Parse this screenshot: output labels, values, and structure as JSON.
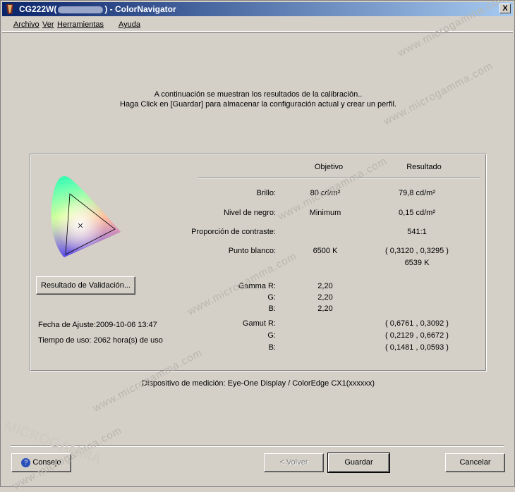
{
  "window": {
    "title_prefix": "CG222W(",
    "title_suffix": ") - ColorNavigator",
    "close_label": "X"
  },
  "menu": {
    "items": [
      "Archivo",
      "Ver",
      "Herramientas",
      "Ayuda"
    ]
  },
  "instructions": {
    "line1": "A continuación se muestran los resultados de la calibración..",
    "line2": "Haga Click en  [Guardar] para almacenar la configuración actual y crear un perfil."
  },
  "left": {
    "validation_button": "Resultado de Validación...",
    "fecha": "Fecha de Ajuste:2009-10-06 13:47",
    "tiempo": "Tiempo de uso: 2062 hora(s) de uso"
  },
  "table": {
    "col_objetivo": "Objetivo",
    "col_resultado": "Resultado",
    "brillo": {
      "label": "Brillo:",
      "objetivo": "80 cd/m²",
      "resultado": "79,8 cd/m²"
    },
    "negro": {
      "label": "Nivel de negro:",
      "objetivo": "Minimum",
      "resultado": "0,15 cd/m²"
    },
    "contraste": {
      "label": "Proporción de contraste:",
      "resultado": "541:1"
    },
    "blanco": {
      "label": "Punto blanco:",
      "objetivo": "6500 K",
      "resultado": "( 0,3120 , 0,3295 )",
      "resultado2": "6539 K"
    },
    "gamma": {
      "label_r": "Gamma R:",
      "label_g": "G:",
      "label_b": "B:",
      "r": "2,20",
      "g": "2,20",
      "b": "2,20"
    },
    "gamut": {
      "label_r": "Gamut R:",
      "label_g": "G:",
      "label_b": "B:",
      "r": "( 0,6761 , 0,3092 )",
      "g": "( 0,2129 , 0,6672 )",
      "b": "( 0,1481 , 0,0593 )"
    }
  },
  "device": "Dispositivo de medición: Eye-One Display / ColorEdge CX1(xxxxxx)",
  "buttons": {
    "consejo": "Consejo",
    "volver": "< Volver",
    "guardar": "Guardar",
    "cancelar": "Cancelar"
  },
  "watermark": {
    "text": "www.microgamma.com",
    "logo": "MICROGAMMA"
  },
  "colors": {
    "titlebar_start": "#0a246a",
    "titlebar_end": "#a6caf0",
    "face": "#d4d0c8"
  },
  "icons": [
    "app-icon",
    "close-icon",
    "help-icon",
    "cie-gamut-diagram"
  ]
}
